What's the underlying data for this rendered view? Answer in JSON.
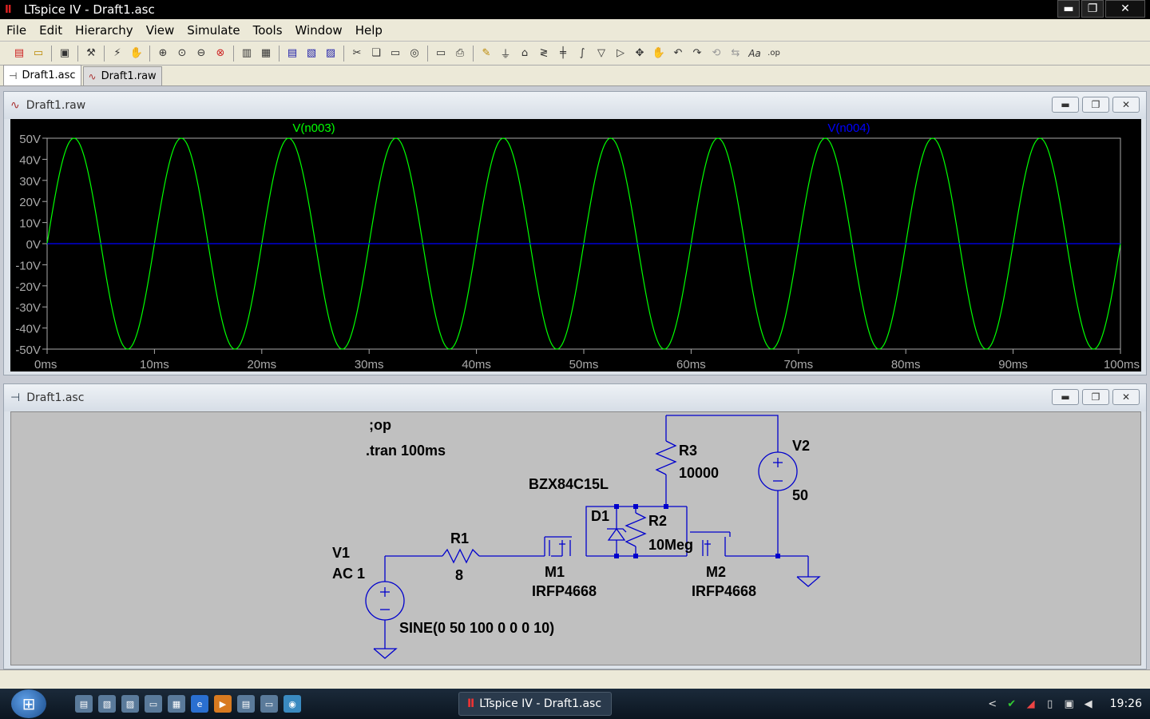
{
  "window": {
    "title": "LTspice IV - Draft1.asc",
    "minimize_glyph": "▬",
    "restore_glyph": "❐",
    "close_glyph": "✕"
  },
  "menu": {
    "items": [
      "File",
      "Edit",
      "Hierarchy",
      "View",
      "Simulate",
      "Tools",
      "Window",
      "Help"
    ]
  },
  "toolbar": {
    "icons": [
      "new-schematic-icon",
      "open-icon",
      "save-icon",
      "control-panel-icon",
      "run-icon",
      "halt-icon",
      "zoom-in-icon",
      "zoom-full-icon",
      "zoom-out-icon",
      "zoom-cancel-icon",
      "autorange-icon",
      "tile-icon",
      "cascade-icon",
      "cut-icon",
      "copy-icon",
      "paste-icon",
      "find-icon",
      "print-setup-icon",
      "print-icon",
      "wire-icon",
      "ground-icon",
      "label-icon",
      "resistor-icon",
      "capacitor-icon",
      "inductor-icon",
      "diode-icon",
      "component-icon",
      "move-icon",
      "drag-icon",
      "undo-icon",
      "redo-icon",
      "rotate-icon",
      "mirror-icon",
      "text-icon",
      "spice-directive-icon"
    ],
    "text_label": "Aa",
    "directive_label": ".op"
  },
  "tabs": [
    {
      "label": "Draft1.asc",
      "icon": "schematic-icon",
      "active": true
    },
    {
      "label": "Draft1.raw",
      "icon": "waveform-icon",
      "active": false
    }
  ],
  "waveform_window": {
    "title": "Draft1.raw"
  },
  "schematic_window": {
    "title": "Draft1.asc"
  },
  "chart_data": {
    "type": "line",
    "xlim": [
      0,
      100
    ],
    "ylim": [
      -50,
      50
    ],
    "x_ticks": [
      "0ms",
      "10ms",
      "20ms",
      "30ms",
      "40ms",
      "50ms",
      "60ms",
      "70ms",
      "80ms",
      "90ms",
      "100ms"
    ],
    "y_ticks": [
      "50V",
      "40V",
      "30V",
      "20V",
      "10V",
      "0V",
      "-10V",
      "-20V",
      "-30V",
      "-40V",
      "-50V"
    ],
    "series": [
      {
        "name": "V(n003)",
        "color": "#00ff00",
        "amplitude": 50,
        "frequency_hz": 100,
        "offset": 0
      },
      {
        "name": "V(n004)",
        "color": "#0000ff",
        "amplitude": 0,
        "frequency_hz": 0,
        "offset": 0
      }
    ]
  },
  "schematic": {
    "directives": [
      ";op",
      ".tran 100ms"
    ],
    "components": {
      "V1": {
        "ref": "V1",
        "value": "AC 1",
        "extra": "SINE(0 50 100 0 0 0 10)"
      },
      "R1": {
        "ref": "R1",
        "value": "8"
      },
      "M1": {
        "ref": "M1",
        "value": "IRFP4668"
      },
      "D1": {
        "ref": "D1",
        "value": "BZX84C15L"
      },
      "R2": {
        "ref": "R2",
        "value": "10Meg"
      },
      "R3": {
        "ref": "R3",
        "value": "10000"
      },
      "M2": {
        "ref": "M2",
        "value": "IRFP4668"
      },
      "V2": {
        "ref": "V2",
        "value": "50"
      }
    },
    "colors": {
      "wire": "#0000cc",
      "component": "#0000cc",
      "text": "#000000",
      "background": "#c0c0c0"
    }
  },
  "taskbar": {
    "task_label": "LTspice IV - Draft1.asc",
    "clock": "19:26",
    "tray_chevron": "<"
  }
}
